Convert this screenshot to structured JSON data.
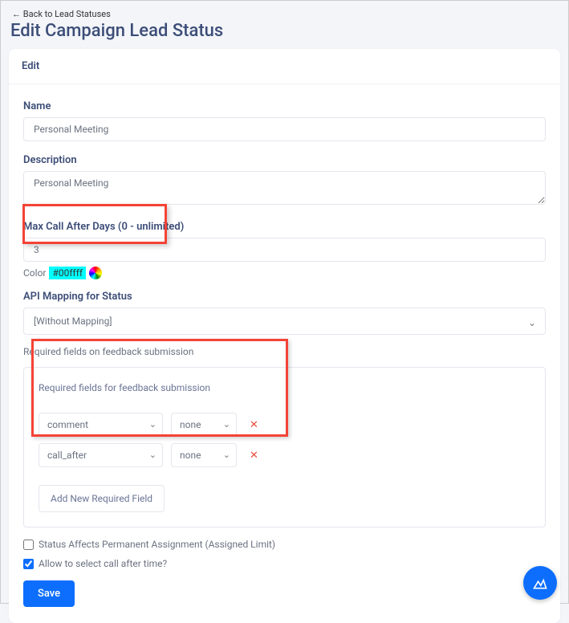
{
  "back_link": "← Back to Lead Statuses",
  "page_title": "Edit Campaign Lead Status",
  "card": {
    "header": "Edit",
    "name_label": "Name",
    "name_value": "Personal Meeting",
    "desc_label": "Description",
    "desc_value": "Personal Meeting",
    "max_call_label": "Max Call After Days (0 - unlimited)",
    "max_call_value": "3",
    "color_label": "Color",
    "color_hex": "#00ffff",
    "api_label": "API Mapping for Status",
    "api_value": "[Without Mapping]",
    "req_label": "Required fields on feedback submission",
    "req_box_title": "Required fields for feedback submission",
    "rows": [
      {
        "field": "comment",
        "cond": "none"
      },
      {
        "field": "call_after",
        "cond": "none"
      }
    ],
    "add_label": "Add New Required Field",
    "check1_label": "Status Affects Permanent Assignment (Assigned Limit)",
    "check1_checked": false,
    "check2_label": "Allow to select call after time?",
    "check2_checked": true,
    "save_label": "Save"
  }
}
